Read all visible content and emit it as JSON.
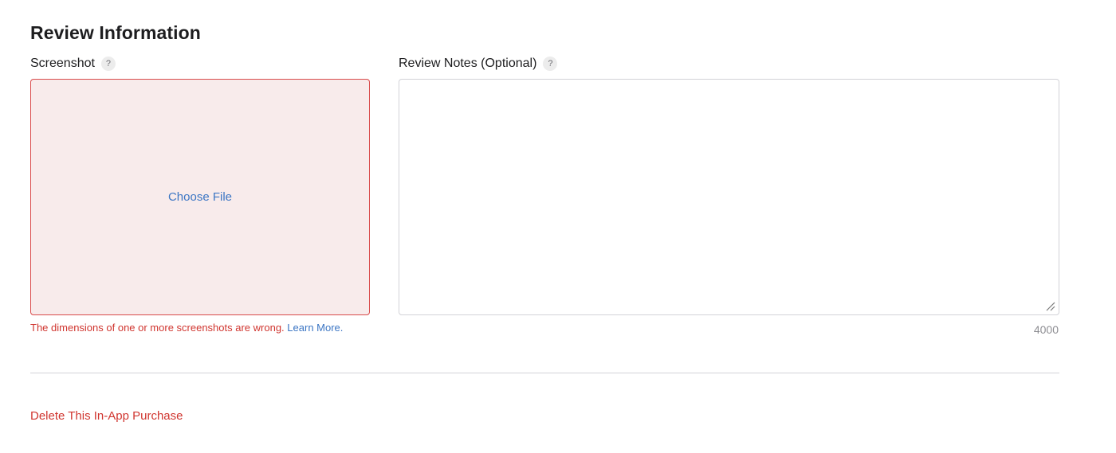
{
  "section": {
    "title": "Review Information"
  },
  "screenshot": {
    "label": "Screenshot",
    "help": "?",
    "choose_file": "Choose File",
    "error": "The dimensions of one or more screenshots are wrong.",
    "learn_more": "Learn More."
  },
  "review_notes": {
    "label": "Review Notes (Optional)",
    "help": "?",
    "value": "",
    "char_count": "4000"
  },
  "footer": {
    "delete_label": "Delete This In-App Purchase"
  },
  "colors": {
    "error_red": "#d0352f",
    "link_blue": "#3c76c4",
    "dropzone_bg": "#f8ebeb"
  }
}
